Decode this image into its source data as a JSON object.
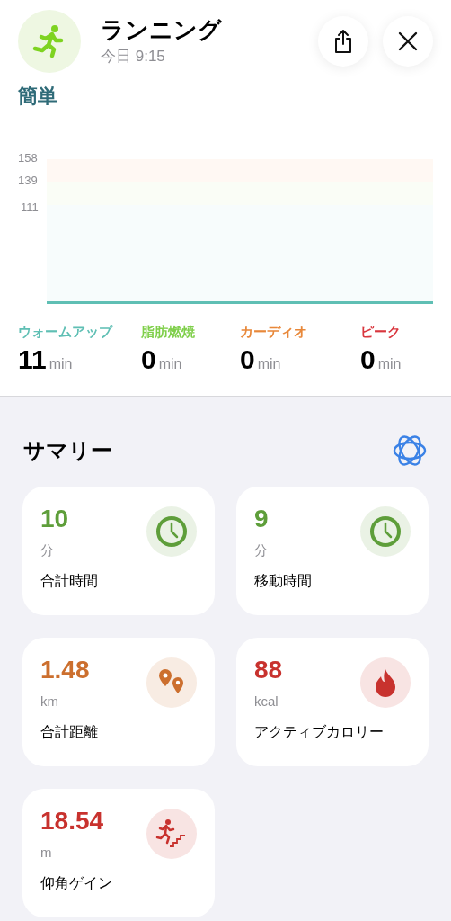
{
  "header": {
    "title": "ランニング",
    "subtitle": "今日 9:15"
  },
  "section_title": "簡単",
  "chart_axis_labels": [
    "158",
    "139",
    "111"
  ],
  "zones": [
    {
      "name": "ウォームアップ",
      "value": "11",
      "unit": "min",
      "color": "#5fbfb4"
    },
    {
      "name": "脂肪燃焼",
      "value": "0",
      "unit": "min",
      "color": "#7fcf4a"
    },
    {
      "name": "カーディオ",
      "value": "0",
      "unit": "min",
      "color": "#e8883a"
    },
    {
      "name": "ピーク",
      "value": "0",
      "unit": "min",
      "color": "#d9363e"
    }
  ],
  "summary": {
    "title": "サマリー",
    "cards": [
      {
        "value": "10",
        "unit": "分",
        "label": "合計時間",
        "kind": "clock",
        "color": "#5e9e3a"
      },
      {
        "value": "9",
        "unit": "分",
        "label": "移動時間",
        "kind": "clock",
        "color": "#5e9e3a"
      },
      {
        "value": "1.48",
        "unit": "km",
        "label": "合計距離",
        "kind": "pins",
        "color": "#cc6f2e"
      },
      {
        "value": "88",
        "unit": "kcal",
        "label": "アクティブカロリー",
        "kind": "flame",
        "color": "#c8322e"
      },
      {
        "value": "18.54",
        "unit": "m",
        "label": "仰角ゲイン",
        "kind": "stairs",
        "color": "#c8322e"
      }
    ]
  }
}
